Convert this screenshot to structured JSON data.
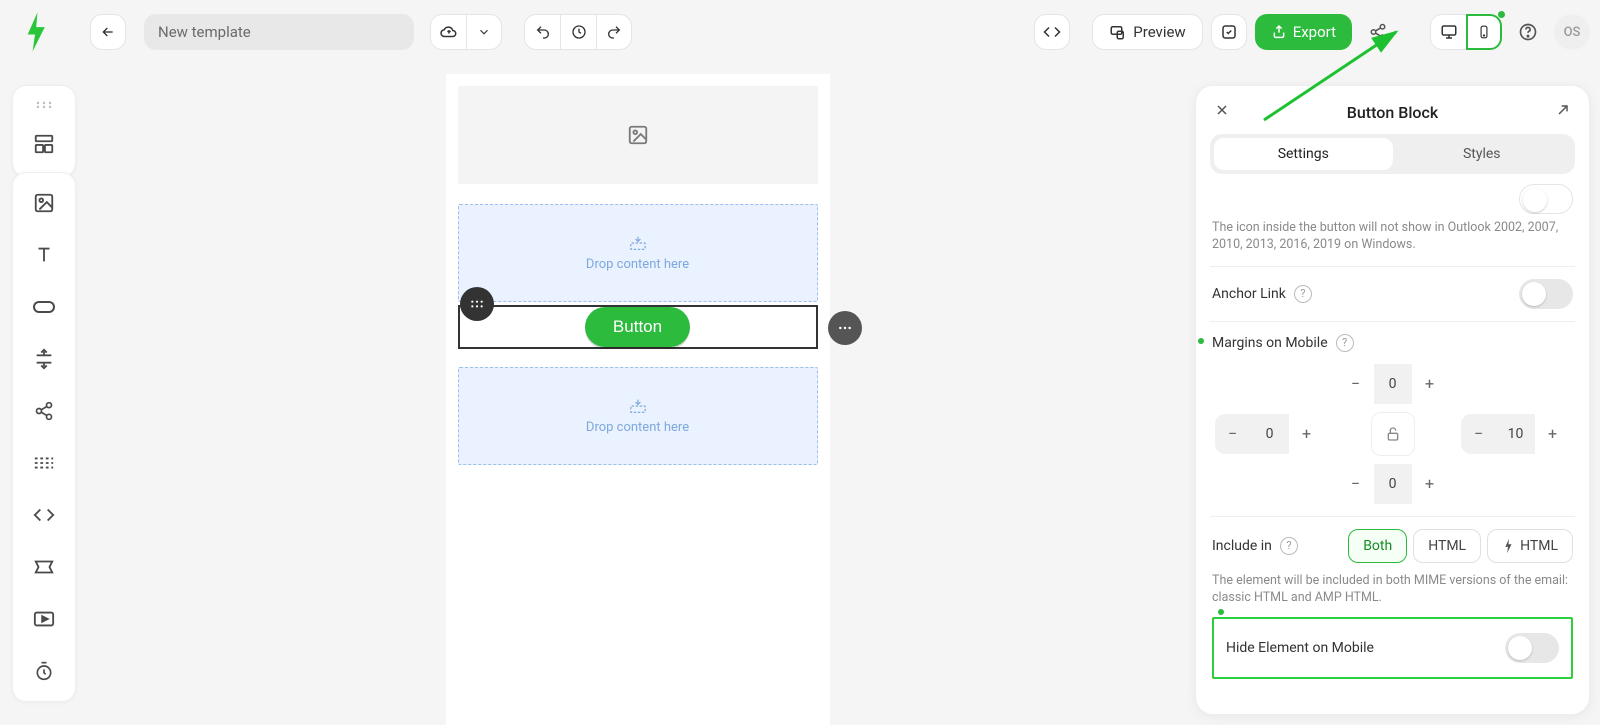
{
  "header": {
    "template_name": "New template",
    "preview_label": "Preview",
    "export_label": "Export",
    "user_initials": "OS"
  },
  "canvas": {
    "dropzone_text": "Drop content here",
    "button_label": "Button"
  },
  "panel": {
    "title": "Button Block",
    "tabs": {
      "settings": "Settings",
      "styles": "Styles"
    },
    "icon_note": "The icon inside the button will not show in Outlook 2002, 2007, 2010, 2013, 2016, 2019 on Windows.",
    "anchor_label": "Anchor Link",
    "margins_label": "Margins on Mobile",
    "margins": {
      "top": "0",
      "right": "10",
      "bottom": "0",
      "left": "0"
    },
    "include_label": "Include in",
    "include_both": "Both",
    "include_html": "HTML",
    "include_amp": "HTML",
    "include_note": "The element will be included in both MIME versions of the email: classic HTML and AMP HTML.",
    "hide_label": "Hide Element on Mobile"
  }
}
